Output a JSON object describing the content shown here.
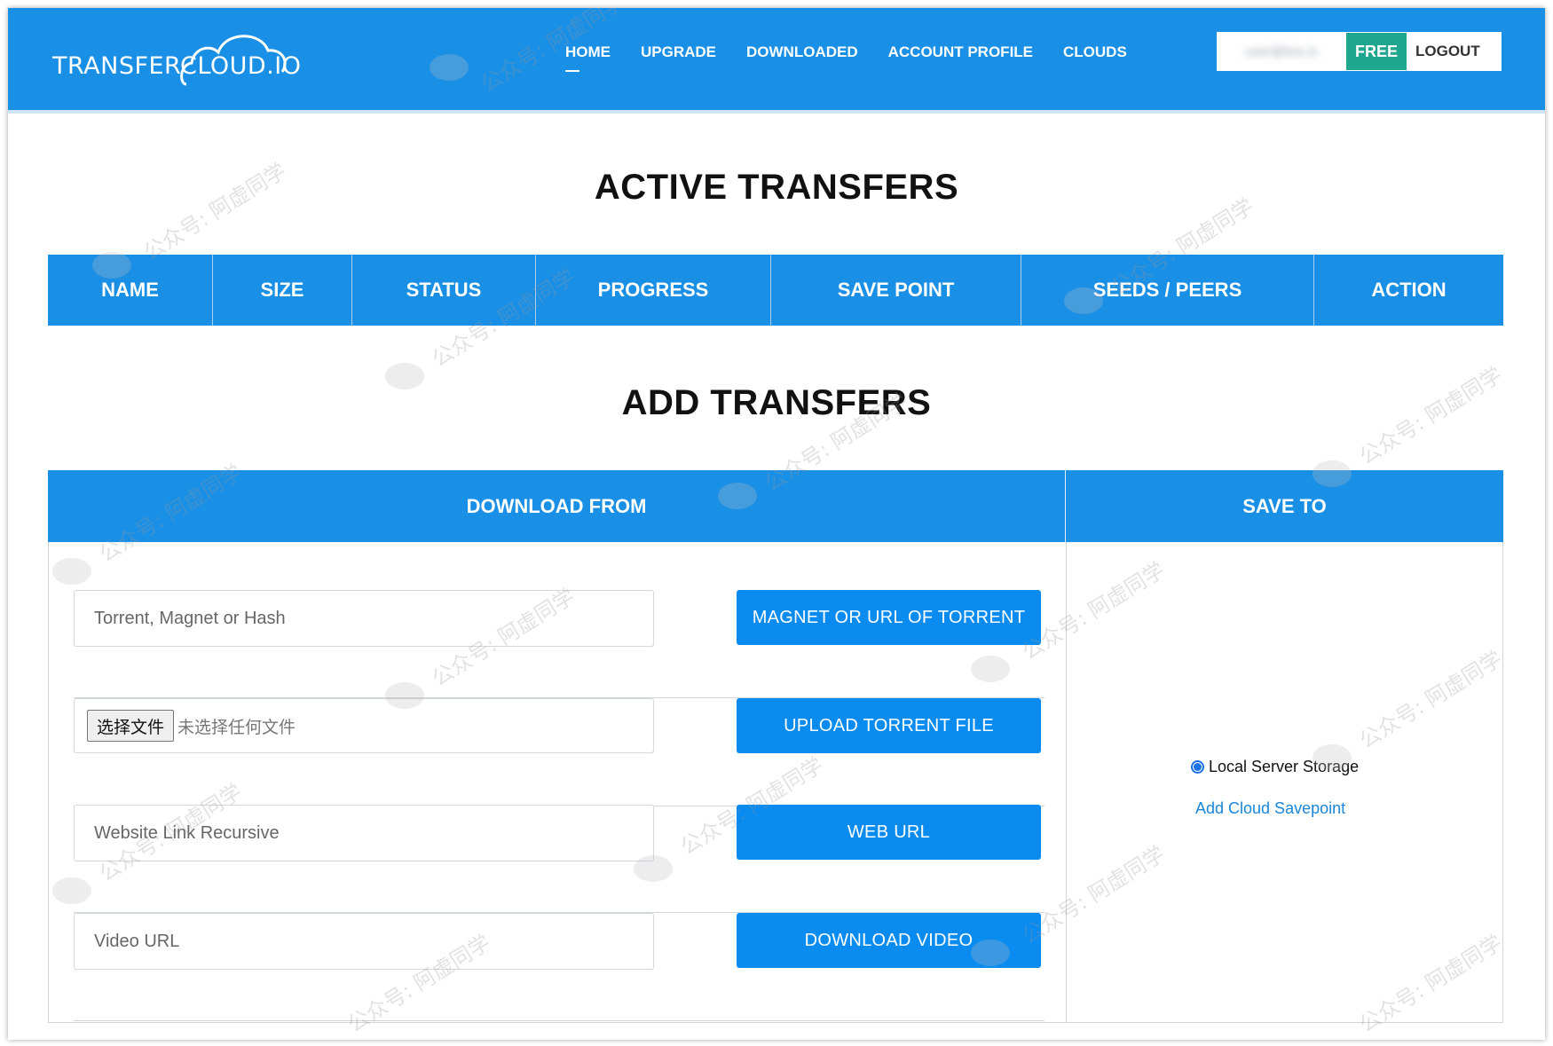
{
  "header": {
    "logo_text": "TRANSFERCLOUD.IO",
    "nav": [
      "HOME",
      "UPGRADE",
      "DOWNLOADED",
      "ACCOUNT PROFILE",
      "CLOUDS"
    ],
    "user_email": "user@live.in",
    "plan_badge": "FREE",
    "logout_label": "LOGOUT"
  },
  "active_transfers": {
    "title": "ACTIVE TRANSFERS",
    "columns": [
      "NAME",
      "SIZE",
      "STATUS",
      "PROGRESS",
      "SAVE POINT",
      "SEEDS / PEERS",
      "ACTION"
    ]
  },
  "add_transfers": {
    "title": "ADD TRANSFERS",
    "download_from_label": "DOWNLOAD FROM",
    "save_to_label": "SAVE TO",
    "torrent_placeholder": "Torrent, Magnet or Hash",
    "magnet_button": "MAGNET OR URL OF TORRENT",
    "file_choose_label": "选择文件",
    "file_status": "未选择任何文件",
    "upload_button": "UPLOAD TORRENT FILE",
    "website_placeholder": "Website Link Recursive",
    "web_url_button": "WEB URL",
    "video_placeholder": "Video URL",
    "download_video_button": "DOWNLOAD VIDEO",
    "storage_option": "Local Server Storage",
    "add_cloud_link": "Add Cloud Savepoint"
  },
  "watermark_text": "公众号: 阿虚同学",
  "colors": {
    "primary_blue": "#1a8fe6",
    "button_blue": "#0a8bef",
    "free_badge": "#1fa68f",
    "link_blue": "#1a86d8"
  }
}
